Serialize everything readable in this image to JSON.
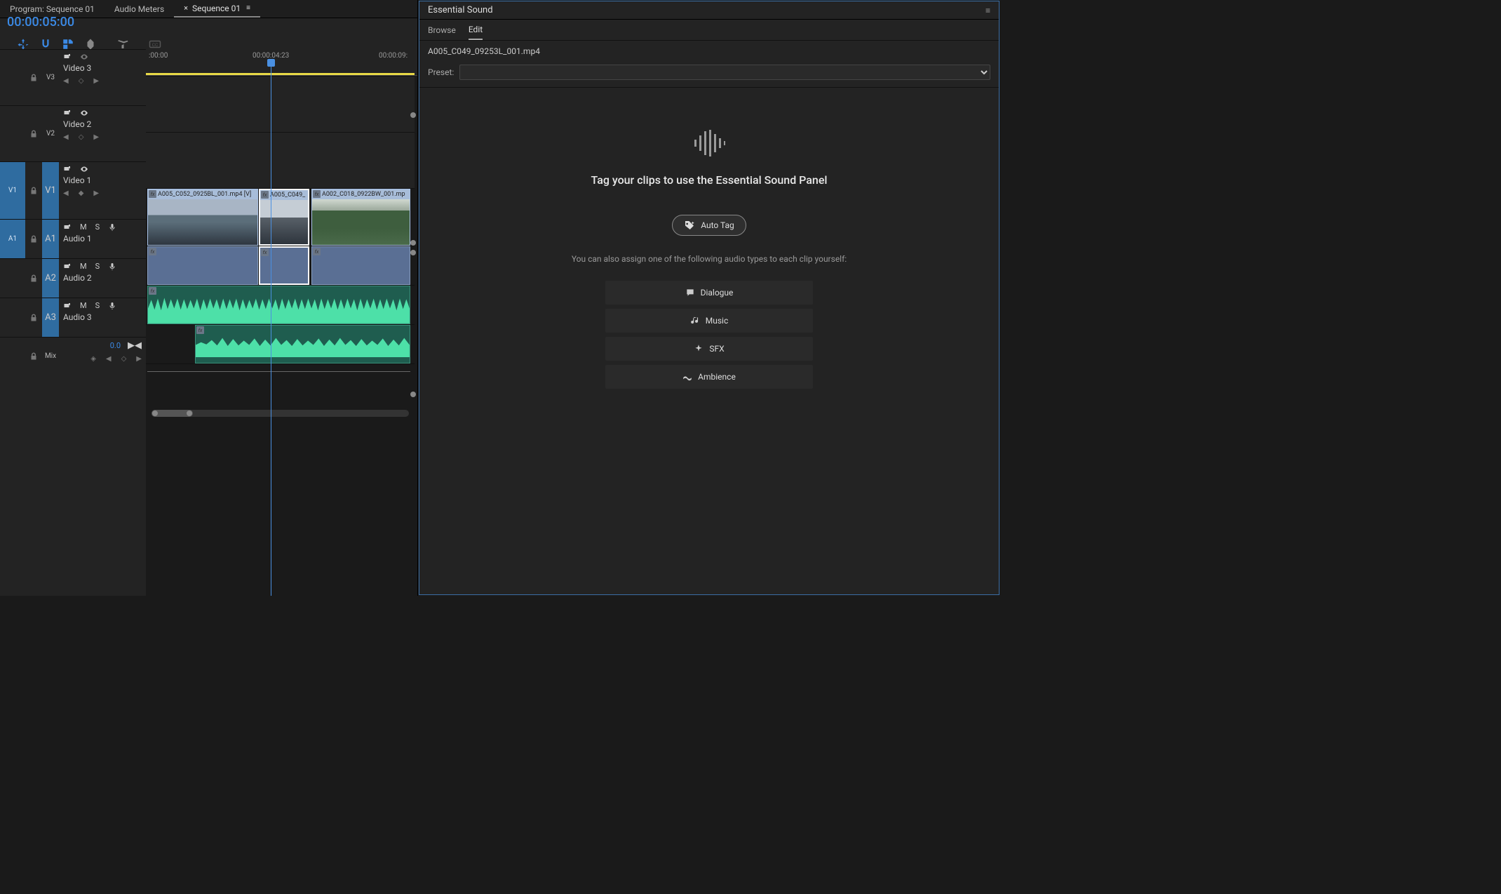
{
  "tabs": {
    "program": "Program: Sequence 01",
    "audiometers": "Audio Meters",
    "sequence": "Sequence 01"
  },
  "timecode": "00:00:05:00",
  "ruler": {
    "t0": ":00:00",
    "t1": "00:00:04:23",
    "t2": "00:00:09:"
  },
  "tracks": {
    "v3": {
      "short": "V3",
      "name": "Video 3"
    },
    "v2": {
      "short": "V2",
      "name": "Video 2"
    },
    "v1": {
      "short": "V1",
      "name": "Video 1"
    },
    "a1": {
      "short": "A1",
      "name": "Audio 1"
    },
    "a2": {
      "short": "A2",
      "name": "Audio 2"
    },
    "a3": {
      "short": "A3",
      "name": "Audio 3"
    },
    "mix": {
      "name": "Mix",
      "value": "0.0"
    }
  },
  "track_btns": {
    "m": "M",
    "s": "S"
  },
  "clips": {
    "v1a": "A005_C052_0925BL_001.mp4 [V]",
    "v1b": "A005_C049_",
    "v1c": "A002_C018_0922BW_001.mp"
  },
  "essential": {
    "title": "Essential Sound",
    "tabs": {
      "browse": "Browse",
      "edit": "Edit"
    },
    "file": "A005_C049_09253L_001.mp4",
    "preset_label": "Preset:",
    "tagline": "Tag your clips to use the Essential Sound Panel",
    "autotag": "Auto Tag",
    "sub": "You can also assign one of the following audio types to each clip yourself:",
    "types": {
      "dialogue": "Dialogue",
      "music": "Music",
      "sfx": "SFX",
      "ambience": "Ambience"
    }
  }
}
